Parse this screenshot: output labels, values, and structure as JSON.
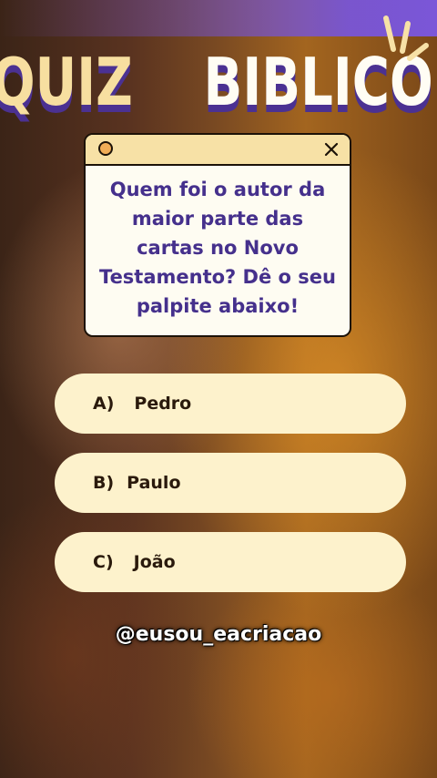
{
  "title": {
    "word1": "QUIZ",
    "word2": "BIBLICO"
  },
  "question": {
    "text": "Quem foi o autor da maior parte das cartas no Novo Testamento? Dê o seu palpite abaixo!"
  },
  "options": [
    {
      "letter": "A)",
      "text": "Pedro"
    },
    {
      "letter": "B)",
      "text": "Paulo"
    },
    {
      "letter": "C)",
      "text": "João"
    }
  ],
  "handle": "@eusou_eacriacao",
  "colors": {
    "title_yellow": "#f7dfa0",
    "title_shadow": "#4b3192",
    "question_text": "#45308c",
    "option_bg": "#fdf2cc",
    "card_bar": "#f7e1a6"
  },
  "icons": [
    "sparkle-icon",
    "circle-dot-icon",
    "close-icon"
  ]
}
